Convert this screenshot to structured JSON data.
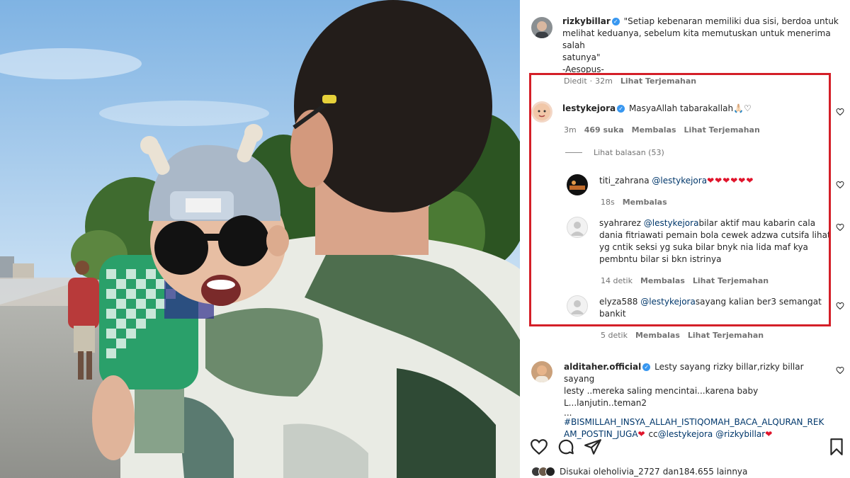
{
  "post": {
    "author": "rizkybillar",
    "caption_line1": "\"Setiap kebenaran memiliki dua sisi, berdoa untuk",
    "caption_line2": "melihat keduanya, sebelum kita memutuskan untuk menerima salah",
    "caption_line3": "satunya\"",
    "caption_line4": "-Aesopus-",
    "edited": "Diedit",
    "time": "32m",
    "translate": "Lihat Terjemahan"
  },
  "comments": [
    {
      "user": "lestykejora",
      "text": "MasyaAllah tabarakallah",
      "emoji": "🙏🏻♡",
      "time": "3m",
      "likes": "469 suka",
      "reply": "Membalas",
      "translate": "Lihat Terjemahan",
      "view_replies": "Lihat balasan (53)"
    }
  ],
  "replies": [
    {
      "user": "titi_zahrana",
      "mention": "@lestykejora",
      "hearts": "❤❤❤❤❤❤",
      "time": "18s",
      "reply": "Membalas"
    },
    {
      "user": "syahrarez",
      "mention": "@lestykejora",
      "text_line1": "bilar aktif mau kabarin cala",
      "text_line2": "dania fitriawati pemain bola cewek adzwa cutsifa lihat",
      "text_line3": "yg cntik seksi yg suka bilar bnyk nia lida maf kya",
      "text_line4": "pembntu bilar si bkn istrinya",
      "time": "14 detik",
      "reply": "Membalas",
      "translate": "Lihat Terjemahan"
    },
    {
      "user": "elyza588",
      "mention": "@lestykejora",
      "text_line1": "sayang kalian ber3 semangat",
      "text_line2": "bankit",
      "time": "5 detik",
      "reply": "Membalas",
      "translate": "Lihat Terjemahan"
    }
  ],
  "comment2": {
    "user": "alditaher.official",
    "text_line1": "Lesty sayang rizky billar,rizky billar sayang",
    "text_line2": "lesty ..mereka saling mencintai...karena baby L...lanjutin..teman2",
    "text_line3": "...",
    "hashtag_line1": "#BISMILLAH_INSYA_ALLAH_ISTIQOMAH_BACA_ALQURAN_REK",
    "hashtag_line2": "AM_POSTIN_JUGA",
    "cc": "cc",
    "mention1": "@lestykejora",
    "mention2": "@rizkybillar"
  },
  "likes": {
    "prefix": "Disukai oleh",
    "user": "olivia_2727",
    "middle": "dan",
    "count": "184.655 lainnya"
  },
  "colors": {
    "highlight_box": "#d41f28",
    "verified": "#3897f0",
    "mention": "#00376b",
    "heart": "#e0142b"
  },
  "icons": [
    "verified-icon",
    "heart-outline-icon",
    "comment-icon",
    "share-icon",
    "bookmark-icon"
  ]
}
